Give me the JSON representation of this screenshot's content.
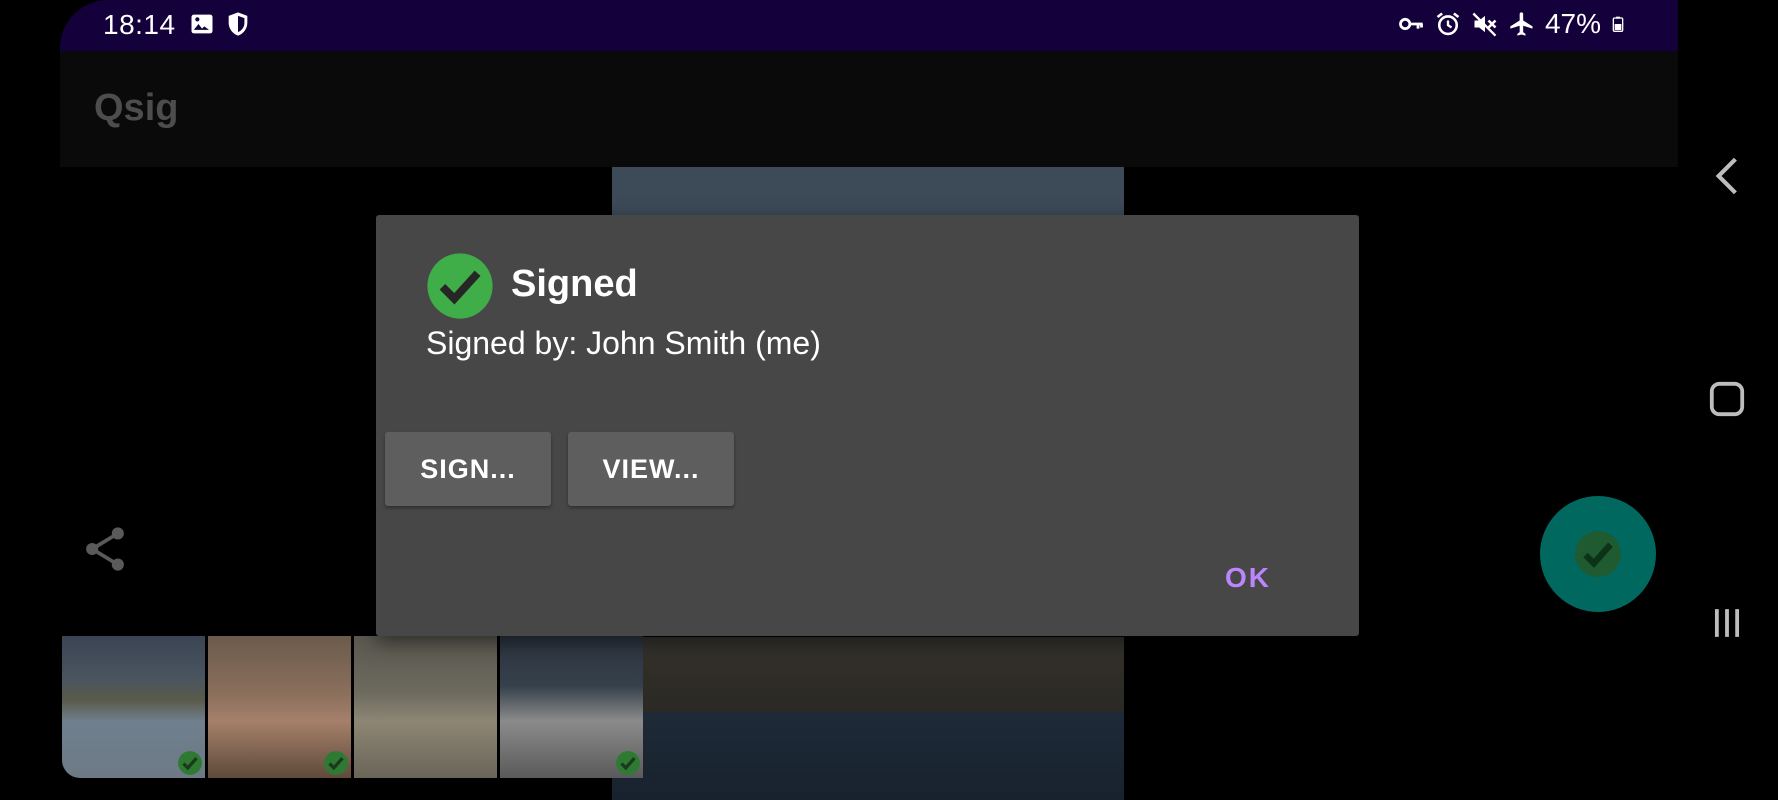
{
  "status_bar": {
    "time": "18:14",
    "battery": "47%",
    "left_icons": [
      "gallery-icon",
      "shield-icon"
    ],
    "right_icons": [
      "vpn-key-icon",
      "alarm-icon",
      "mute-icon",
      "airplane-icon",
      "battery-icon"
    ]
  },
  "app_bar": {
    "title": "Qsig"
  },
  "dialog": {
    "title": "Signed",
    "message": "Signed by: John Smith (me)",
    "buttons": {
      "sign": "SIGN...",
      "view": "VIEW..."
    },
    "ok": "OK"
  },
  "thumbnails": [
    {
      "subject": "coastal town",
      "signed": true
    },
    {
      "subject": "man portrait",
      "signed": true
    },
    {
      "subject": "woman blonde",
      "signed": false
    },
    {
      "subject": "white sports car",
      "signed": true
    }
  ],
  "colors": {
    "status_bar": "#14003a",
    "dialog_bg": "#474747",
    "check_green": "#3fae48",
    "ok_accent": "#bb86fc",
    "fab": "#01685f"
  }
}
